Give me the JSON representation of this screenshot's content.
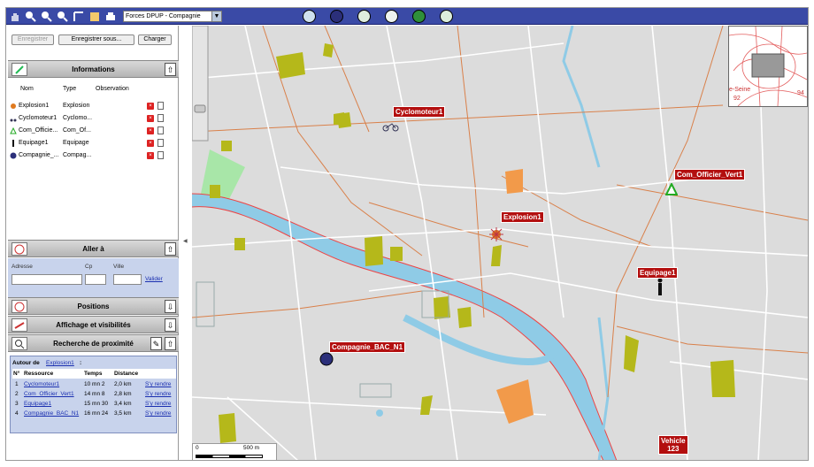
{
  "toolbar": {
    "layer_select": "Forces DPUP - Compagnie"
  },
  "left": {
    "buttons": {
      "save": "Enregistrer",
      "save_as": "Enregistrer sous...",
      "load": "Charger"
    },
    "informations": {
      "title": "Informations",
      "columns": [
        "Nom",
        "Type",
        "Observation"
      ],
      "rows": [
        {
          "nom": "Explosion1",
          "type": "Explosion"
        },
        {
          "nom": "Cyclomoteur1",
          "type": "Cyclomo..."
        },
        {
          "nom": "Com_Officie...",
          "type": "Com_Of..."
        },
        {
          "nom": "Equipage1",
          "type": "Equipage"
        },
        {
          "nom": "Compagnie_...",
          "type": "Compag..."
        }
      ]
    },
    "aller": {
      "title": "Aller à",
      "adresse": "Adresse",
      "cp": "Cp",
      "ville": "Ville",
      "valider": "Valider"
    },
    "positions": {
      "title": "Positions"
    },
    "affichage": {
      "title": "Affichage et visibilités"
    },
    "recherche": {
      "title": "Recherche de proximité"
    },
    "prox": {
      "autour": "Autour de",
      "autour_target": "Explosion1",
      "autour_colon": ":",
      "headers": [
        "N°",
        "Ressource",
        "Temps",
        "Distance"
      ],
      "rows": [
        {
          "n": "1",
          "res": "Cyclomoteur1",
          "temps": "10 mn 2",
          "dist": "2,0 km",
          "act": "S'y rendre"
        },
        {
          "n": "2",
          "res": "Com_Officier_Vert1",
          "temps": "14 mn 8",
          "dist": "2,8 km",
          "act": "S'y rendre"
        },
        {
          "n": "3",
          "res": "Equipage1",
          "temps": "15 mn 30",
          "dist": "3,4 km",
          "act": "S'y rendre"
        },
        {
          "n": "4",
          "res": "Compagnie_BAC_N1",
          "temps": "16 mn 24",
          "dist": "3,5 km",
          "act": "S'y rendre"
        }
      ]
    }
  },
  "map": {
    "labels": {
      "cyclo": "Cyclomoteur1",
      "officier": "Com_Officier_Vert1",
      "explosion": "Explosion1",
      "equipage": "Equipage1",
      "compagnie": "Compagnie_BAC_N1",
      "vehicle_a": "Vehicle",
      "vehicle_b": "123"
    },
    "scale": {
      "zero": "0",
      "len": "500 m"
    },
    "overview": {
      "place": "e-Seine",
      "n94": "94",
      "n92": "92"
    }
  },
  "colors": {
    "toolbar": "#3a4aa6",
    "label": "#b30f0f",
    "river": "#8fcbe6",
    "park": "#b5b81a",
    "orange": "#f29a4a"
  }
}
